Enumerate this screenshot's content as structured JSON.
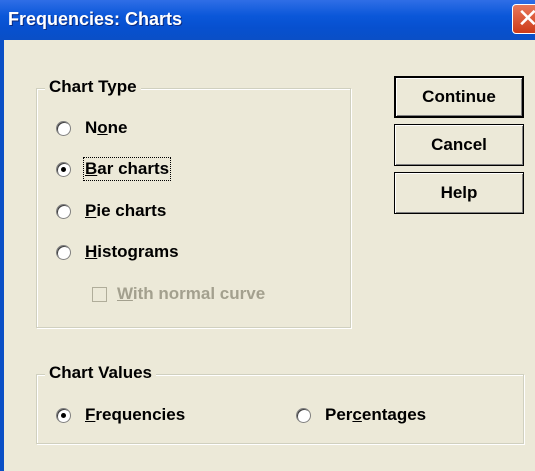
{
  "window": {
    "title": "Frequencies: Charts"
  },
  "chart_type": {
    "legend": "Chart Type",
    "options": [
      {
        "label_pre": "N",
        "label_u": "o",
        "label_post": "ne",
        "checked": false
      },
      {
        "label_pre": "",
        "label_u": "B",
        "label_post": "ar charts",
        "checked": true
      },
      {
        "label_pre": "",
        "label_u": "P",
        "label_post": "ie charts",
        "checked": false
      },
      {
        "label_pre": "",
        "label_u": "H",
        "label_post": "istograms",
        "checked": false
      }
    ],
    "normal_curve": {
      "label_u": "W",
      "label_post": "ith normal curve",
      "checked": false,
      "enabled": false
    }
  },
  "chart_values": {
    "legend": "Chart Values",
    "frequencies": {
      "label_u": "F",
      "label_post": "requencies",
      "checked": true
    },
    "percentages": {
      "label_pre": "Per",
      "label_u": "c",
      "label_post": "entages",
      "checked": false
    }
  },
  "buttons": {
    "continue": "Continue",
    "cancel": "Cancel",
    "help": "Help"
  }
}
